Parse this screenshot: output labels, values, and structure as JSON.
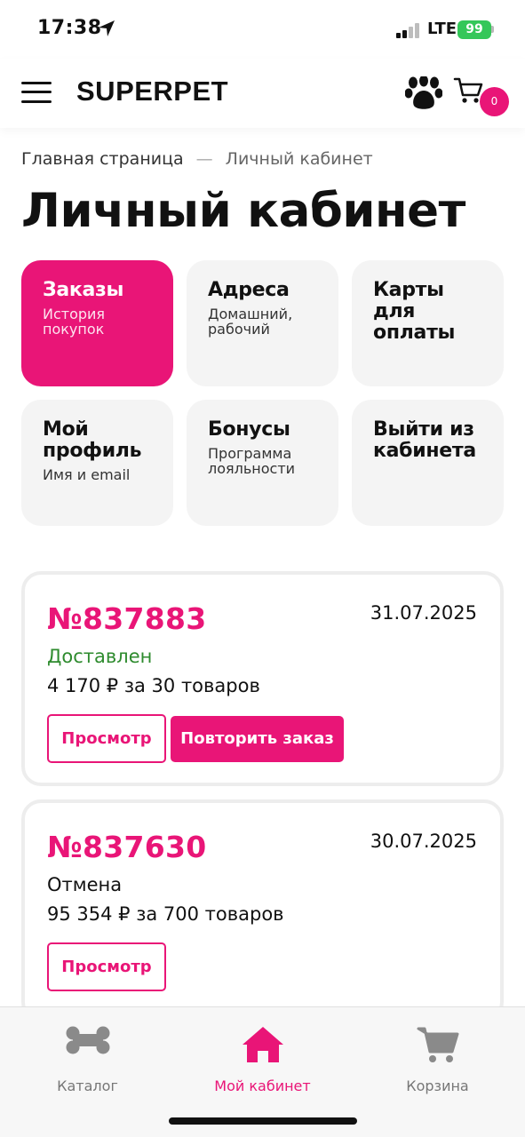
{
  "status_bar": {
    "time": "17:38",
    "network": "LTE",
    "battery": "99"
  },
  "header": {
    "logo": "SUPERPET",
    "cart_count": "0"
  },
  "breadcrumb": {
    "home": "Главная страница",
    "separator": "—",
    "current": "Личный кабинет"
  },
  "page_title": "Личный кабинет",
  "tiles": [
    {
      "title": "Заказы",
      "subtitle": "История покупок",
      "active": true
    },
    {
      "title": "Адреса",
      "subtitle": "Домашний, рабочий",
      "active": false
    },
    {
      "title": "Карты для оплаты",
      "subtitle": "",
      "active": false
    },
    {
      "title": "Мой профиль",
      "subtitle": "Имя и email",
      "active": false
    },
    {
      "title": "Бонусы",
      "subtitle": "Программа лояльности",
      "active": false
    },
    {
      "title": "Выйти из кабинета",
      "subtitle": "",
      "active": false
    }
  ],
  "orders": [
    {
      "number": "№837883",
      "date": "31.07.2025",
      "status": "Доставлен",
      "status_color": "#2e8b2e",
      "total": "4 170 ₽ за 30 товаров",
      "view_label": "Просмотр",
      "repeat_label": "Повторить заказ"
    },
    {
      "number": "№837630",
      "date": "30.07.2025",
      "status": "Отмена",
      "status_color": "#111111",
      "total": "95 354 ₽ за 700 товаров",
      "view_label": "Просмотр"
    }
  ],
  "tab_bar": {
    "items": [
      {
        "label": "Каталог",
        "icon": "bone-icon",
        "active": false
      },
      {
        "label": "Мой кабинет",
        "icon": "home-icon",
        "active": true
      },
      {
        "label": "Корзина",
        "icon": "cart-icon",
        "active": false
      }
    ]
  },
  "colors": {
    "accent": "#e91577",
    "tile_bg": "#f4f4f4",
    "delivered": "#2e8b2e",
    "battery": "#34c759"
  }
}
